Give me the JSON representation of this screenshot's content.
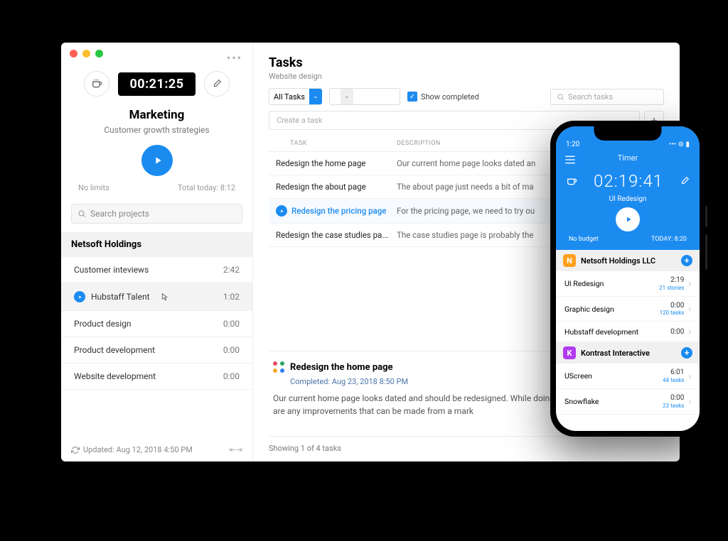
{
  "desktop": {
    "timer": "00:21:25",
    "title": "Marketing",
    "subtitle": "Customer growth strategies",
    "no_limits": "No limits",
    "total_today": "Total today: 8:12",
    "search_placeholder": "Search projects",
    "group": "Netsoft Holdings",
    "projects": [
      {
        "name": "Customer inteviews",
        "time": "2:42",
        "playing": false,
        "active": false
      },
      {
        "name": "Hubstaff Talent",
        "time": "1:02",
        "playing": true,
        "active": true
      },
      {
        "name": "Product design",
        "time": "0:00",
        "playing": false,
        "active": false
      },
      {
        "name": "Product development",
        "time": "0:00",
        "playing": false,
        "active": false
      },
      {
        "name": "Website development",
        "time": "0:00",
        "playing": false,
        "active": false
      }
    ],
    "updated": "Updated: Aug 12, 2018 4:50 PM"
  },
  "main": {
    "heading": "Tasks",
    "crumb": "Website design",
    "filter": "All Tasks",
    "show_completed": "Show completed",
    "search_placeholder": "Search tasks",
    "create_placeholder": "Create a task",
    "cols": {
      "task": "TASK",
      "desc": "DESCRIPTION"
    },
    "rows": [
      {
        "task": "Redesign the home page",
        "desc": "Our current home page looks dated an",
        "sel": false
      },
      {
        "task": "Redesign the about page",
        "desc": "The about page just needs a bit of ma",
        "sel": false
      },
      {
        "task": "Redesign the pricing page",
        "desc": "For the pricing page, we need to try ou",
        "sel": true
      },
      {
        "task": "Redesign the case studies pa...",
        "desc": "The case studies page is probably the",
        "sel": false
      }
    ],
    "detail": {
      "title": "Redesign the home page",
      "completed": "Completed: Aug 23, 2018 8:50 PM",
      "body": "Our current home page looks dated and should be redesigned. While doing th section and see if there are any improvements that can be made from a mark"
    },
    "footer": "Showing 1 of 4 tasks"
  },
  "phone": {
    "status_time": "1:20",
    "title": "Timer",
    "big_time": "02:19:41",
    "proj": "UI Redesign",
    "budget": "No budget",
    "today": "TODAY: 8:20",
    "orgs": [
      {
        "badge": "N",
        "color": "#ff9f1c",
        "name": "Netsoft Holdings LLC"
      },
      {
        "badge": "K",
        "color": "#b13af0",
        "name": "Kontrast Interactive"
      }
    ],
    "lists": [
      [
        {
          "name": "UI Redesign",
          "time": "2:19",
          "sub": "21 stories"
        },
        {
          "name": "Graphic design",
          "time": "0:00",
          "sub": "120 tasks"
        },
        {
          "name": "Hubstaff development",
          "time": "0:00",
          "sub": ""
        }
      ],
      [
        {
          "name": "UScreen",
          "time": "6:01",
          "sub": "44 tasks"
        },
        {
          "name": "Snowflake",
          "time": "0:00",
          "sub": "23 tasks"
        }
      ]
    ]
  }
}
